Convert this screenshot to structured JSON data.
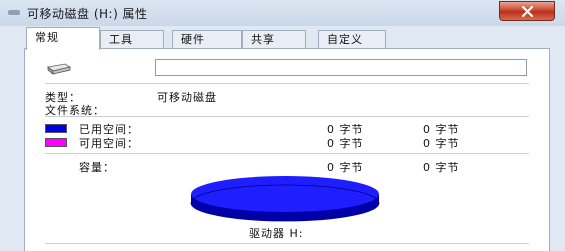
{
  "window": {
    "title": "可移动磁盘 (H:) 属性",
    "close_color": "#c8422d"
  },
  "tabs": [
    {
      "label": "常规",
      "active": true
    },
    {
      "label": "工具",
      "active": false
    },
    {
      "label": "硬件",
      "active": false
    },
    {
      "label": "共享",
      "active": false
    },
    {
      "label": "自定义",
      "active": false
    }
  ],
  "general": {
    "name_value": "",
    "type_label": "类型：",
    "type_value": "可移动磁盘",
    "fs_label": "文件系统：",
    "fs_value": "",
    "used": {
      "label": "已用空间：",
      "bytes": "0 字节",
      "size": "0 字节",
      "color": "#0000e0"
    },
    "free": {
      "label": "可用空间：",
      "bytes": "0 字节",
      "size": "0 字节",
      "color": "#ff00ff"
    },
    "capacity": {
      "label": "容量：",
      "bytes": "0 字节",
      "size": "0 字节"
    },
    "drive_label": "驱动器 H:"
  },
  "icons": {
    "title": "removable-drive-icon",
    "drive": "removable-drive-icon",
    "close": "close-icon"
  }
}
